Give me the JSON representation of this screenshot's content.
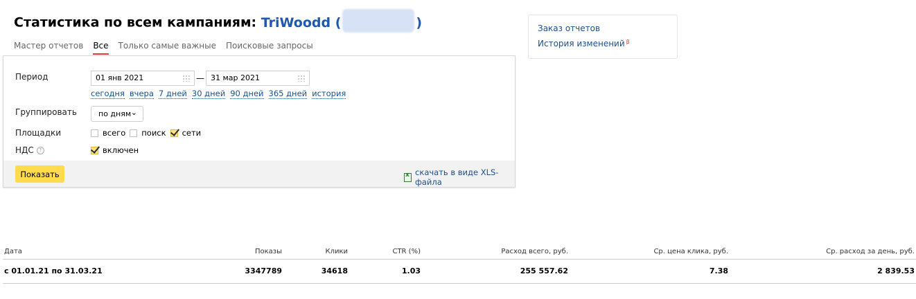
{
  "header": {
    "title_prefix": "Статистика по всем кампаниям:",
    "client_name": "TriWoodd (",
    "client_suffix": ")"
  },
  "tabs": [
    {
      "label": "Мастер отчетов",
      "active": false
    },
    {
      "label": "Все",
      "active": true
    },
    {
      "label": "Только самые важные",
      "active": false
    },
    {
      "label": "Поисковые запросы",
      "active": false
    }
  ],
  "sidebar": {
    "order_reports": "Заказ отчетов",
    "change_history": "История изменений",
    "beta_mark": "β"
  },
  "form": {
    "period_label": "Период",
    "date_from": "01 янв 2021",
    "date_dash": "—",
    "date_to": "31 мар 2021",
    "quick_ranges": [
      "сегодня",
      "вчера",
      "7 дней",
      "30 дней",
      "90 дней",
      "365 дней",
      "история"
    ],
    "group_label": "Группировать",
    "group_value": "по дням",
    "platforms_label": "Площадки",
    "platforms": [
      {
        "label": "всего",
        "checked": false
      },
      {
        "label": "поиск",
        "checked": false
      },
      {
        "label": "сети",
        "checked": true
      }
    ],
    "vat_label": "НДС",
    "vat_help": "?",
    "vat_option": {
      "label": "включен",
      "checked": true
    },
    "show_button": "Показать",
    "download_xls": "скачать в виде XLS-файла"
  },
  "table": {
    "headers": [
      "Дата",
      "Показы",
      "Клики",
      "CTR (%)",
      "Расход всего, руб.",
      "Ср. цена клика, руб.",
      "Ср. расход за день, руб."
    ],
    "rows": [
      [
        "с 01.01.21 по 31.03.21",
        "3347789",
        "34618",
        "1.03",
        "255 557.62",
        "7.38",
        "2 839.53"
      ]
    ]
  },
  "colors": {
    "accent_tab": "#e8383d",
    "link": "#1a4f8f",
    "client_name": "#1e58b0",
    "button": "#ffdb4d"
  }
}
